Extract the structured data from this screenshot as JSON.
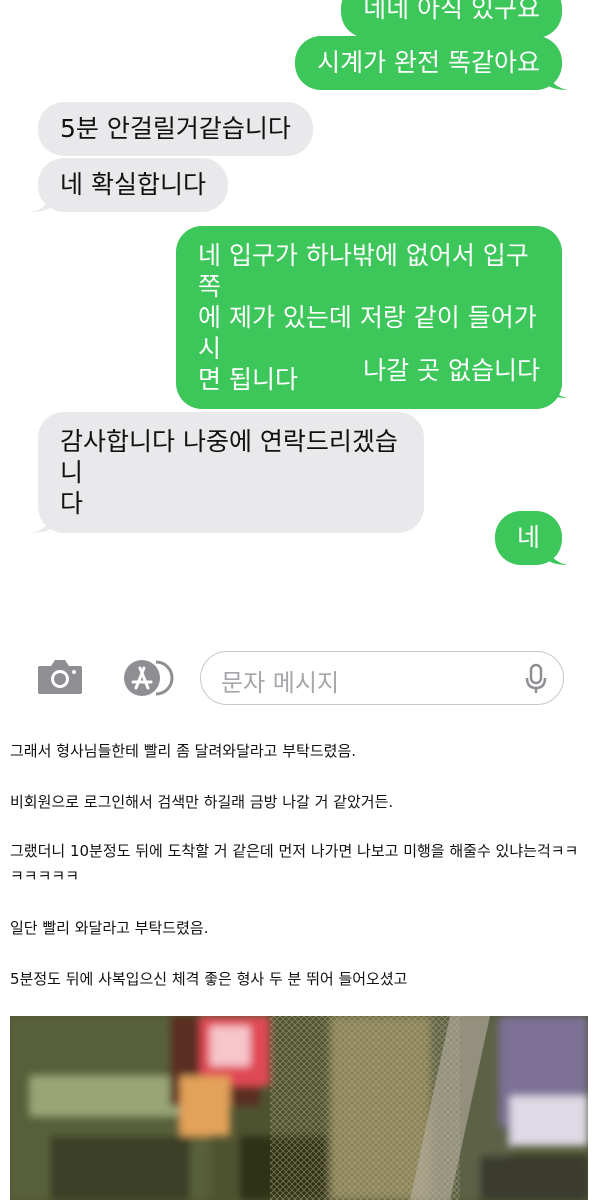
{
  "messages": [
    {
      "from": "sent",
      "text": "네네 아직 있구요"
    },
    {
      "from": "sent",
      "text": "시계가 완전 똑같아요"
    },
    {
      "from": "recv",
      "text": "5분 안걸릴거같습니다"
    },
    {
      "from": "recv",
      "text": "네 확실합니다"
    },
    {
      "from": "sent",
      "lines": [
        "네 입구가 하나밖에 없어서 입구쪽",
        "에 제가 있는데 저랑 같이 들어가시",
        "면 됩니다"
      ]
    },
    {
      "from": "sent",
      "text": "나갈 곳 없습니다"
    },
    {
      "from": "recv",
      "lines": [
        "감사합니다 나중에 연락드리겠습니",
        "다"
      ]
    },
    {
      "from": "sent",
      "text": "네"
    }
  ],
  "composer": {
    "placeholder": "문자 메시지",
    "camera_icon": "camera-icon",
    "apps_icon": "app-store-icon",
    "mic_icon": "microphone-icon"
  },
  "article": {
    "paragraphs": [
      "그래서 형사님들한테 빨리 좀 달려와달라고 부탁드렸음.",
      "비회원으로 로그인해서 검색만 하길래 금방 나갈 거 같았거든.",
      "그랬더니 10분정도 뒤에 도착할 거 같은데 먼저 나가면 나보고 미행을 해줄수 있냐는걱ㅋㅋ",
      "ㅋㅋㅋㅋㅋ",
      "일단 빨리 와달라고 부탁드렸음.",
      "5분정도 뒤에 사복입으신 체격 좋은 형사 두 분 뛰어 들어오셨고"
    ]
  },
  "colors": {
    "sent_bubble": "#3dc65a",
    "recv_bubble": "#e9e9eb",
    "placeholder": "#a7a7ab"
  }
}
